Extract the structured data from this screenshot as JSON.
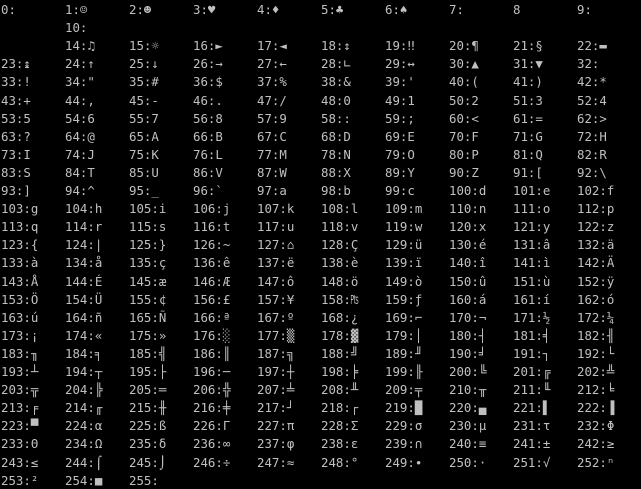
{
  "terminal": {
    "background": "#000000",
    "foreground": "#c0c0c0",
    "rows": [
      [
        "0:",
        "1:☺",
        "2:☻",
        "3:♥",
        "4:♦",
        "5:♣",
        "6:♠",
        "7:",
        "8",
        "9:"
      ],
      [
        "",
        "10:",
        "",
        "",
        "",
        "",
        "",
        "",
        "",
        ""
      ],
      [
        "",
        "14:♫",
        "15:☼",
        "16:►",
        "17:◄",
        "18:↕",
        "19:‼",
        "20:¶",
        "21:§",
        "22:▬"
      ],
      [
        "23:↨",
        "24:↑",
        "25:↓",
        "26:→",
        "27:←",
        "28:∟",
        "29:↔",
        "30:▲",
        "31:▼",
        "32:"
      ],
      [
        "33:!",
        "34:\"",
        "35:#",
        "36:$",
        "37:%",
        "38:&",
        "39:'",
        "40:(",
        "41:)",
        "42:*"
      ],
      [
        "43:+",
        "44:,",
        "45:-",
        "46:.",
        "47:/",
        "48:0",
        "49:1",
        "50:2",
        "51:3",
        "52:4"
      ],
      [
        "53:5",
        "54:6",
        "55:7",
        "56:8",
        "57:9",
        "58::",
        "59:;",
        "60:<",
        "61:=",
        "62:>"
      ],
      [
        "63:?",
        "64:@",
        "65:A",
        "66:B",
        "67:C",
        "68:D",
        "69:E",
        "70:F",
        "71:G",
        "72:H"
      ],
      [
        "73:I",
        "74:J",
        "75:K",
        "76:L",
        "77:M",
        "78:N",
        "79:O",
        "80:P",
        "81:Q",
        "82:R"
      ],
      [
        "83:S",
        "84:T",
        "85:U",
        "86:V",
        "87:W",
        "88:X",
        "89:Y",
        "90:Z",
        "91:[",
        "92:\\"
      ],
      [
        "93:]",
        "94:^",
        "95:_",
        "96:`",
        "97:a",
        "98:b",
        "99:c",
        "100:d",
        "101:e",
        "102:f"
      ],
      [
        "103:g",
        "104:h",
        "105:i",
        "106:j",
        "107:k",
        "108:l",
        "109:m",
        "110:n",
        "111:o",
        "112:p"
      ],
      [
        "113:q",
        "114:r",
        "115:s",
        "116:t",
        "117:u",
        "118:v",
        "119:w",
        "120:x",
        "121:y",
        "122:z"
      ],
      [
        "123:{",
        "124:|",
        "125:}",
        "126:~",
        "127:⌂",
        "128:Ç",
        "129:ü",
        "130:é",
        "131:â",
        "132:ä"
      ],
      [
        "133:à",
        "134:å",
        "135:ç",
        "136:ê",
        "137:ë",
        "138:è",
        "139:ï",
        "140:î",
        "141:ì",
        "142:Ä"
      ],
      [
        "143:Å",
        "144:É",
        "145:æ",
        "146:Æ",
        "147:ô",
        "148:ö",
        "149:ò",
        "150:û",
        "151:ù",
        "152:ÿ"
      ],
      [
        "153:Ö",
        "154:Ü",
        "155:¢",
        "156:£",
        "157:¥",
        "158:₧",
        "159:ƒ",
        "160:á",
        "161:í",
        "162:ó"
      ],
      [
        "163:ú",
        "164:ñ",
        "165:Ñ",
        "166:ª",
        "167:º",
        "168:¿",
        "169:⌐",
        "170:¬",
        "171:½",
        "172:¼"
      ],
      [
        "173:¡",
        "174:«",
        "175:»",
        "176:░",
        "177:▒",
        "178:▓",
        "179:│",
        "180:┤",
        "181:╡",
        "182:╢"
      ],
      [
        "183:╖",
        "184:╕",
        "185:╣",
        "186:║",
        "187:╗",
        "188:╝",
        "189:╜",
        "190:╛",
        "191:┐",
        "192:└"
      ],
      [
        "193:┴",
        "194:┬",
        "195:├",
        "196:─",
        "197:┼",
        "198:╞",
        "199:╟",
        "200:╚",
        "201:╔",
        "202:╩"
      ],
      [
        "203:╦",
        "204:╠",
        "205:═",
        "206:╬",
        "207:╧",
        "208:╨",
        "209:╤",
        "210:╥",
        "211:╙",
        "212:╘"
      ],
      [
        "213:╒",
        "214:╓",
        "215:╫",
        "216:╪",
        "217:┘",
        "218:┌",
        "219:█",
        "220:▄",
        "221:▌",
        "222:▐"
      ],
      [
        "223:▀",
        "224:α",
        "225:ß",
        "226:Γ",
        "227:π",
        "228:Σ",
        "229:σ",
        "230:µ",
        "231:τ",
        "232:Φ"
      ],
      [
        "233:Θ",
        "234:Ω",
        "235:δ",
        "236:∞",
        "237:φ",
        "238:ε",
        "239:∩",
        "240:≡",
        "241:±",
        "242:≥"
      ],
      [
        "243:≤",
        "244:⌠",
        "245:⌡",
        "246:÷",
        "247:≈",
        "248:°",
        "249:∙",
        "250:·",
        "251:√",
        "252:ⁿ"
      ],
      [
        "253:²",
        "254:■",
        "255:",
        "",
        "",
        "",
        "",
        "",
        "",
        ""
      ]
    ]
  }
}
